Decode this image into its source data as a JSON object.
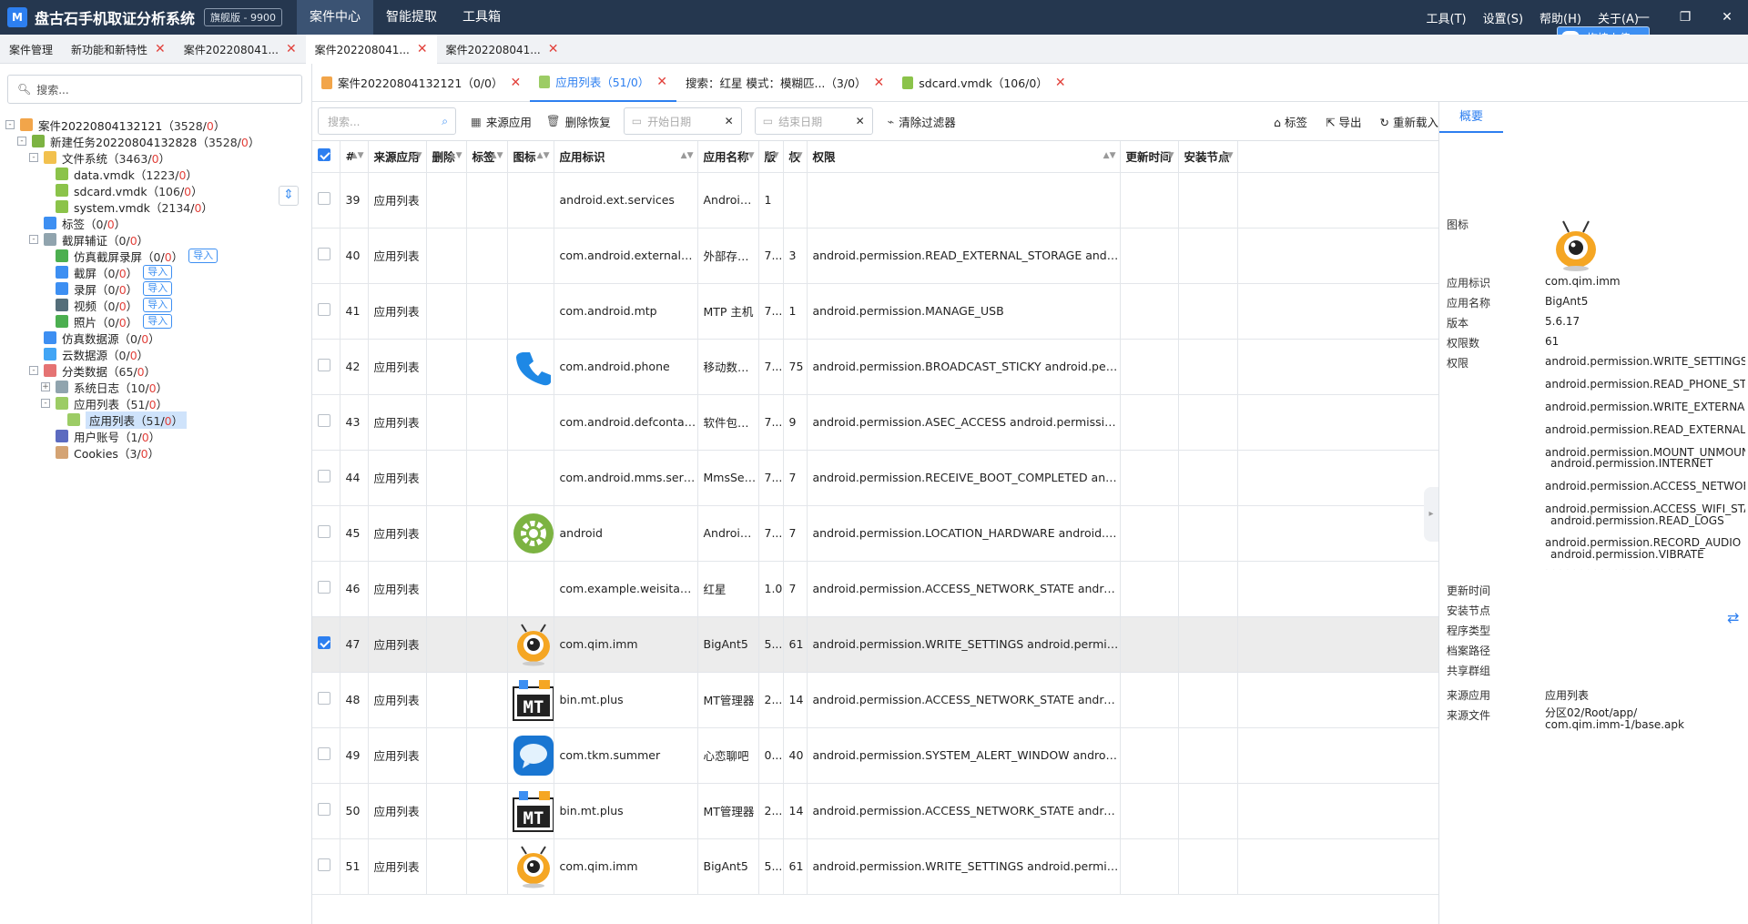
{
  "titlebar": {
    "logo": "M",
    "title": "盘古石手机取证分析系统",
    "edition": "旗舰版 - 9900",
    "nav": [
      "案件中心",
      "智能提取",
      "工具箱"
    ],
    "menu": [
      "工具(T)",
      "设置(S)",
      "帮助(H)",
      "关于(A)"
    ],
    "upload": "拖拽上传"
  },
  "tabs": [
    {
      "label": "案件管理",
      "close": false
    },
    {
      "label": "新功能和新特性",
      "close": true
    },
    {
      "label": "案件202208041...",
      "close": true
    },
    {
      "label": "案件202208041...",
      "close": true,
      "active": true
    },
    {
      "label": "案件202208041...",
      "close": true
    }
  ],
  "left": {
    "search_placeholder": "搜索...",
    "tree": [
      {
        "label": "案件20220804132121",
        "cnt": "3528",
        "red": "0",
        "level": 0,
        "tog": "-",
        "icon": "#f2a54a"
      },
      {
        "label": "新建任务20220804132828",
        "cnt": "3528",
        "red": "0",
        "level": 1,
        "tog": "-",
        "icon": "#7cb342"
      },
      {
        "label": "文件系统",
        "cnt": "3463",
        "red": "0",
        "level": 2,
        "tog": "-",
        "icon": "#f2c14e"
      },
      {
        "label": "data.vmdk",
        "cnt": "1223",
        "red": "0",
        "level": 3,
        "icon": "#8bc34a"
      },
      {
        "label": "sdcard.vmdk",
        "cnt": "106",
        "red": "0",
        "level": 3,
        "icon": "#8bc34a"
      },
      {
        "label": "system.vmdk",
        "cnt": "2134",
        "red": "0",
        "level": 3,
        "icon": "#8bc34a"
      },
      {
        "label": "标签",
        "cnt": "0",
        "red": "0",
        "level": 2,
        "icon": "#3d8ff2"
      },
      {
        "label": "截屏辅证",
        "cnt": "0",
        "red": "0",
        "level": 2,
        "tog": "-",
        "icon": "#90a4ae"
      },
      {
        "label": "仿真截屏录屏",
        "cnt": "0",
        "red": "0",
        "level": 3,
        "icon": "#4caf50",
        "imp": "导入"
      },
      {
        "label": "截屏",
        "cnt": "0",
        "red": "0",
        "level": 3,
        "icon": "#3d8ff2",
        "imp": "导入"
      },
      {
        "label": "录屏",
        "cnt": "0",
        "red": "0",
        "level": 3,
        "icon": "#3d8ff2",
        "imp": "导入"
      },
      {
        "label": "视频",
        "cnt": "0",
        "red": "0",
        "level": 3,
        "icon": "#546e7a",
        "imp": "导入"
      },
      {
        "label": "照片",
        "cnt": "0",
        "red": "0",
        "level": 3,
        "icon": "#4caf50",
        "imp": "导入"
      },
      {
        "label": "仿真数据源",
        "cnt": "0",
        "red": "0",
        "level": 2,
        "icon": "#3d8ff2"
      },
      {
        "label": "云数据源",
        "cnt": "0",
        "red": "0",
        "level": 2,
        "icon": "#42a5f5"
      },
      {
        "label": "分类数据",
        "cnt": "65",
        "red": "0",
        "level": 2,
        "tog": "-",
        "icon": "#e57373"
      },
      {
        "label": "系统日志",
        "cnt": "10",
        "red": "0",
        "level": 3,
        "tog": "+",
        "icon": "#90a4ae"
      },
      {
        "label": "应用列表",
        "cnt": "51",
        "red": "0",
        "level": 3,
        "tog": "-",
        "icon": "#9ccc65"
      },
      {
        "label": "应用列表",
        "cnt": "51",
        "red": "0",
        "level": 4,
        "icon": "#9ccc65",
        "sel": true
      },
      {
        "label": "用户账号",
        "cnt": "1",
        "red": "0",
        "level": 3,
        "icon": "#5c6bc0"
      },
      {
        "label": "Cookies",
        "cnt": "3",
        "red": "0",
        "level": 3,
        "icon": "#d4a373"
      }
    ]
  },
  "subtabs": [
    {
      "label": "案件20220804132121（0/0）",
      "color": "#f2a54a"
    },
    {
      "label": "应用列表（51/0）",
      "color": "#9ccc65",
      "active": true
    },
    {
      "label": "搜索：红星 模式：模糊匹...（3/0）",
      "color": ""
    },
    {
      "label": "sdcard.vmdk（106/0）",
      "color": "#8bc34a"
    }
  ],
  "toolbar": {
    "search_placeholder": "搜索...",
    "source_app": "来源应用",
    "delete_restore": "删除恢复",
    "start_date": "开始日期",
    "end_date": "结束日期",
    "clear_filter": "清除过滤器",
    "tag": "标签",
    "export": "导出",
    "reload": "重新载入"
  },
  "table": {
    "headers": [
      "#",
      "来源应用",
      "删除",
      "标签",
      "图标",
      "应用标识",
      "应用名称",
      "版",
      "权",
      "权限",
      "更新时间",
      "安装节点"
    ],
    "rows": [
      {
        "n": "39",
        "src": "应用列表",
        "icon": "",
        "id": "android.ext.services",
        "name": "Android S...",
        "ver": "1",
        "pc": "",
        "perm": ""
      },
      {
        "n": "40",
        "src": "应用列表",
        "icon": "",
        "id": "com.android.externalstorage",
        "name": "外部存储...",
        "ver": "7...",
        "pc": "3",
        "perm": "android.permission.READ_EXTERNAL_STORAGE  android.permission...."
      },
      {
        "n": "41",
        "src": "应用列表",
        "icon": "",
        "id": "com.android.mtp",
        "name": "MTP 主机",
        "ver": "7...",
        "pc": "1",
        "perm": "android.permission.MANAGE_USB"
      },
      {
        "n": "42",
        "src": "应用列表",
        "icon": "phone",
        "id": "com.android.phone",
        "name": "移动数据...",
        "ver": "7...",
        "pc": "75",
        "perm": "android.permission.BROADCAST_STICKY  android.permission.CALL_P..."
      },
      {
        "n": "43",
        "src": "应用列表",
        "icon": "",
        "id": "com.android.defcontainer",
        "name": "软件包权...",
        "ver": "7...",
        "pc": "9",
        "perm": "android.permission.ASEC_ACCESS  android.permission.ASEC_CREATE..."
      },
      {
        "n": "44",
        "src": "应用列表",
        "icon": "",
        "id": "com.android.mms.service",
        "name": "MmsServi...",
        "ver": "7...",
        "pc": "7",
        "perm": "android.permission.RECEIVE_BOOT_COMPLETED  android.permission...."
      },
      {
        "n": "45",
        "src": "应用列表",
        "icon": "gear",
        "id": "android",
        "name": "Android...",
        "ver": "7...",
        "pc": "7",
        "perm": "android.permission.LOCATION_HARDWARE  android.permission.GET..."
      },
      {
        "n": "46",
        "src": "应用列表",
        "icon": "",
        "id": "com.example.weisitas526sad",
        "name": "红星",
        "ver": "1.0",
        "pc": "7",
        "perm": "android.permission.ACCESS_NETWORK_STATE  android.permission.R..."
      },
      {
        "n": "47",
        "src": "应用列表",
        "icon": "ant",
        "id": "com.qim.imm",
        "name": "BigAnt5",
        "ver": "5...",
        "pc": "61",
        "perm": "android.permission.WRITE_SETTINGS  android.permission.READ_PHO...",
        "sel": true
      },
      {
        "n": "48",
        "src": "应用列表",
        "icon": "mt",
        "id": "bin.mt.plus",
        "name": "MT管理器",
        "ver": "2...",
        "pc": "14",
        "perm": "android.permission.ACCESS_NETWORK_STATE  android.permission.A..."
      },
      {
        "n": "49",
        "src": "应用列表",
        "icon": "chat",
        "id": "com.tkm.summer",
        "name": "心恋聊吧",
        "ver": "0...",
        "pc": "40",
        "perm": "android.permission.SYSTEM_ALERT_WINDOW  android.permission.W..."
      },
      {
        "n": "50",
        "src": "应用列表",
        "icon": "mt",
        "id": "bin.mt.plus",
        "name": "MT管理器",
        "ver": "2...",
        "pc": "14",
        "perm": "android.permission.ACCESS_NETWORK_STATE  android.permission.A..."
      },
      {
        "n": "51",
        "src": "应用列表",
        "icon": "ant",
        "id": "com.qim.imm",
        "name": "BigAnt5",
        "ver": "5...",
        "pc": "61",
        "perm": "android.permission.WRITE_SETTINGS  android.permission.READ_PHO..."
      }
    ]
  },
  "detail": {
    "tab": "概要",
    "labels": {
      "icon": "图标",
      "id": "应用标识",
      "name": "应用名称",
      "version": "版本",
      "perm_count": "权限数",
      "perms": "权限",
      "update": "更新时间",
      "install": "安装节点",
      "type": "程序类型",
      "path": "档案路径",
      "group": "共享群组",
      "src_app": "来源应用",
      "src_file": "来源文件"
    },
    "values": {
      "id": "com.qim.imm",
      "name": "BigAnt5",
      "version": "5.6.17",
      "perm_count": "61",
      "src_app": "应用列表",
      "src_file_1": "分区02/Root/app/",
      "src_file_2": "com.qim.imm-1/base.apk"
    },
    "perms": [
      "android.permission.WRITE_SETTINGS",
      "android.permission.READ_PHONE_STATE",
      "android.permission.WRITE_EXTERNAL_STORAGE",
      "android.permission.READ_EXTERNAL_STORAGE",
      "android.permission.MOUNT_UNMOUNT_FILESYSTEMS",
      "android.permission.INTERNET",
      "android.permission.ACCESS_NETWORK_STATE",
      "android.permission.ACCESS_WIFI_STATE",
      "android.permission.READ_LOGS",
      "android.permission.RECORD_AUDIO",
      "android.permission.VIBRATE"
    ]
  }
}
